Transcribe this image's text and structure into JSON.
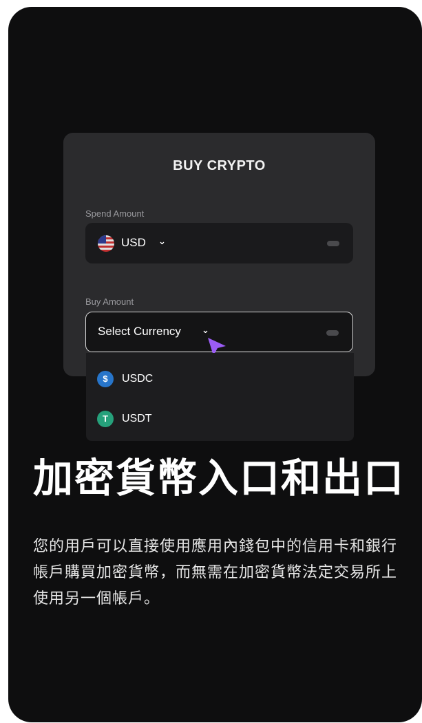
{
  "card": {
    "title": "BUY CRYPTO",
    "spend": {
      "label": "Spend Amount",
      "currency": "USD",
      "flag_icon": "us-flag-icon"
    },
    "buy": {
      "label": "Buy Amount",
      "placeholder": "Select Currency"
    }
  },
  "dropdown": {
    "options": [
      {
        "label": "USDC",
        "icon": "usdc-icon",
        "color": "#2775ca"
      },
      {
        "label": "USDT",
        "icon": "tether-icon",
        "color": "#26a17b"
      }
    ]
  },
  "headline": "加密貨幣入口和出口",
  "description": "您的用戶可以直接使用應用內錢包中的信用卡和銀行帳戶購買加密貨幣，而無需在加密貨幣法定交易所上使用另一個帳戶。",
  "colors": {
    "background": "#0e0e0f",
    "card": "#2b2b2d",
    "cursor": "#9b5cf6"
  }
}
